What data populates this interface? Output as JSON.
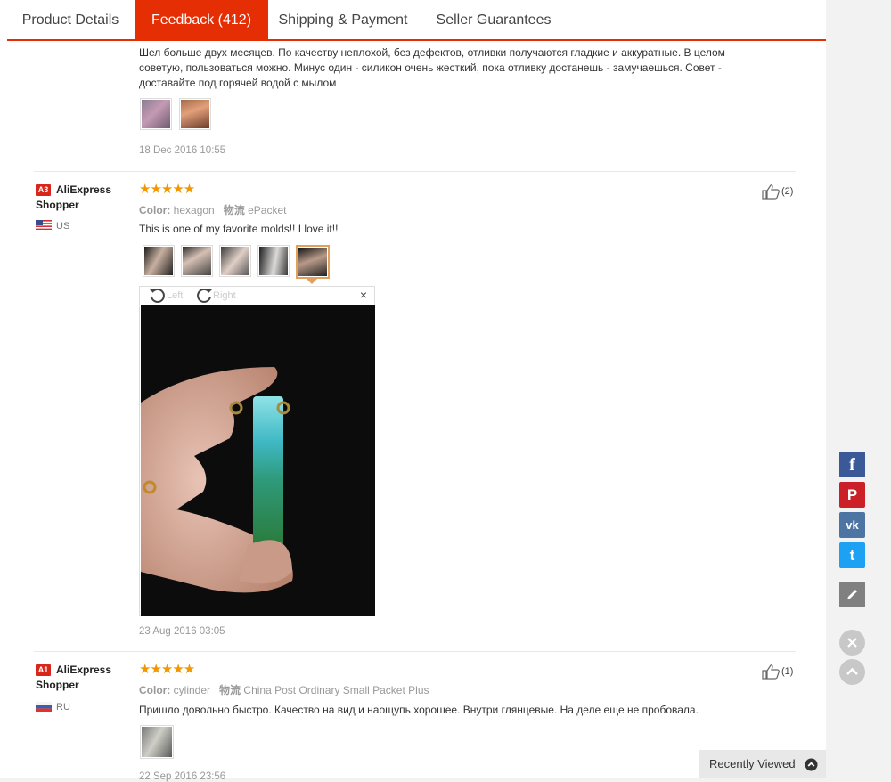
{
  "tabs": [
    {
      "label": "Product Details"
    },
    {
      "label": "Feedback (412)"
    },
    {
      "label": "Shipping & Payment"
    },
    {
      "label": "Seller Guarantees"
    }
  ],
  "review0": {
    "text_lines": [
      "Шел больше двух месяцев. По качеству неплохой, без дефектов, отливки получаются гладкие и аккуратные. В целом",
      "советую, пользоваться можно. Минус один - силикон очень жесткий, пока отливку достанешь - замучаешься. Совет -",
      "доставайте под горячей водой с мылом"
    ],
    "date": "18 Dec 2016 10:55"
  },
  "review1": {
    "level": "A3",
    "user_line1": "AliExpress",
    "user_line2": "Shopper",
    "country": "US",
    "stars": "★★★★★",
    "color_label": "Color:",
    "color_value": "hexagon",
    "shipping_label": "物流",
    "shipping_value": "ePacket",
    "helpful_count": "(2)",
    "text": "This is one of my favorite molds!! I love it!!",
    "date": "23 Aug 2016 03:05",
    "viewer": {
      "rotate_left": "Left",
      "rotate_right": "Right",
      "close": "×"
    }
  },
  "review2": {
    "level": "A1",
    "user_line1": "AliExpress",
    "user_line2": "Shopper",
    "country": "RU",
    "stars": "★★★★★",
    "color_label": "Color:",
    "color_value": "cylinder",
    "shipping_label": "物流",
    "shipping_value": "China Post Ordinary Small Packet Plus",
    "helpful_count": "(1)",
    "text": "Пришло довольно быстро. Качество на вид и наощупь хорошее. Внутри глянцевые. На деле еще не пробовала.",
    "date": "22 Sep 2016 23:56"
  },
  "share": {
    "facebook": "f",
    "pinterest": "P",
    "vk": "vk",
    "twitter": "t"
  },
  "recently_viewed": "Recently Viewed",
  "colors": {
    "accent": "#e62e04",
    "star": "#f09800",
    "facebook": "#3b5998",
    "pinterest": "#cb2027",
    "vk": "#4c75a3",
    "twitter": "#1da1f2",
    "edit": "#808080"
  },
  "icons": [
    "thumbs-up-icon",
    "rotate-left-icon",
    "rotate-right-icon",
    "close-icon",
    "facebook-icon",
    "pinterest-icon",
    "vk-icon",
    "twitter-icon",
    "pencil-icon",
    "chevron-up-icon"
  ]
}
